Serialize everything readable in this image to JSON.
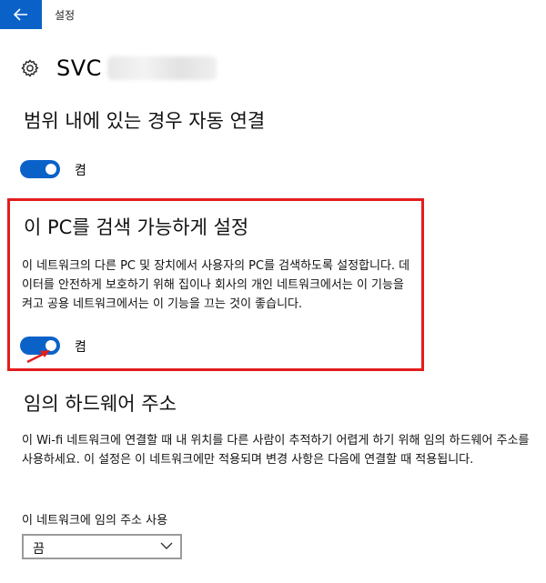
{
  "titlebar": {
    "title": "설정"
  },
  "header": {
    "network_name": "SVC"
  },
  "auto_connect": {
    "title": "범위 내에 있는 경우 자동 연결",
    "toggle_state": "켬"
  },
  "discoverable": {
    "title": "이 PC를 검색 가능하게 설정",
    "description": "이 네트워크의 다른 PC 및 장치에서 사용자의 PC를 검색하도록 설정합니다. 데이터를 안전하게 보호하기 위해 집이나 회사의 개인 네트워크에서는 이 기능을 켜고 공용 네트워크에서는 이 기능을 끄는 것이 좋습니다.",
    "toggle_state": "켬"
  },
  "random_hw": {
    "title": "임의 하드웨어 주소",
    "description": "이 Wi-fi 네트워크에 연결할 때 내 위치를 다른 사람이 추적하기 어렵게 하기 위해 임의 하드웨어 주소를 사용하세요. 이 설정은 이 네트워크에만 적용되며 변경 사항은 다음에 연결할 때 적용됩니다.",
    "dropdown_caption": "이 네트워크에 임의 주소 사용",
    "dropdown_value": "끔"
  },
  "colors": {
    "accent": "#0a62c9",
    "highlight": "#e31d1d"
  }
}
